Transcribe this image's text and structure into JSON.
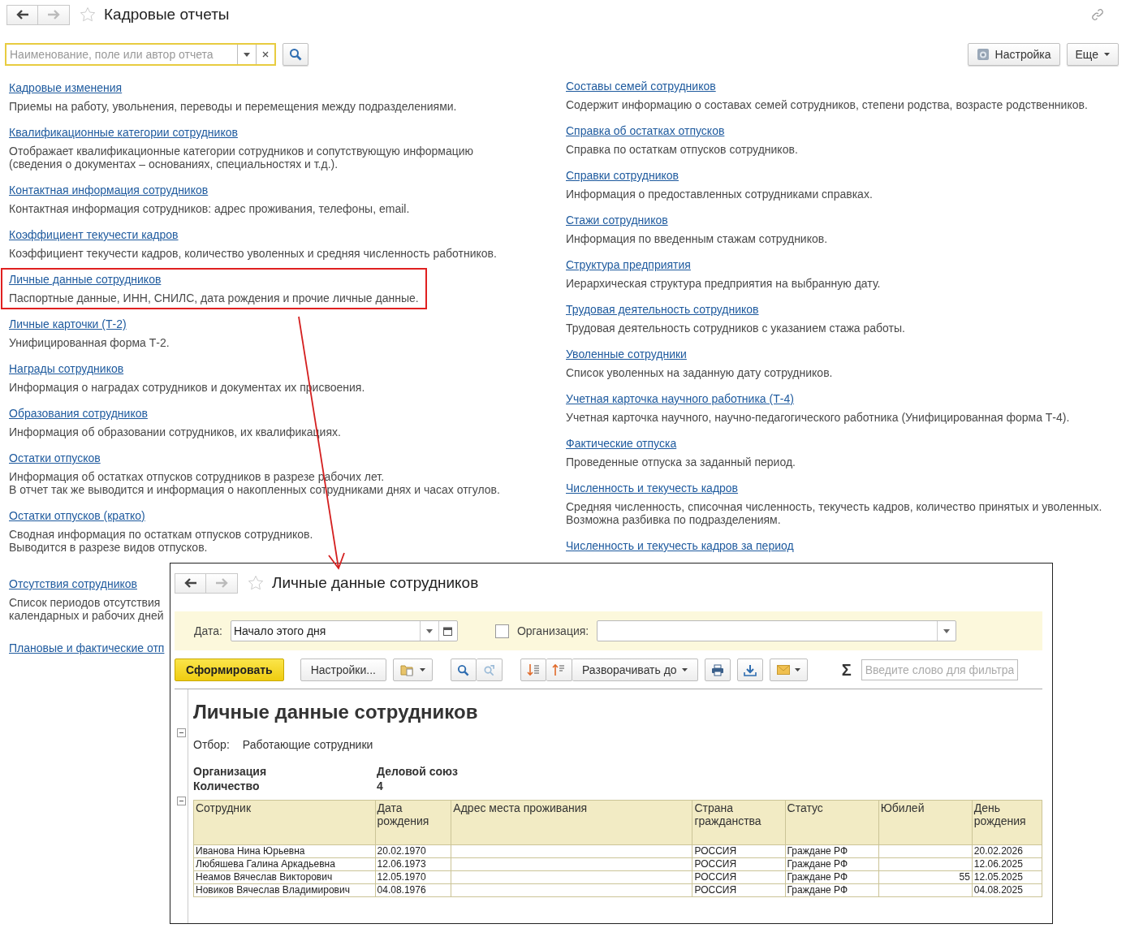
{
  "page": {
    "title": "Кадровые отчеты",
    "search": {
      "placeholder": "Наименование, поле или автор отчета"
    },
    "buttons": [
      {
        "label": "Настройка"
      },
      {
        "label": "Еще"
      }
    ]
  },
  "left_column": [
    {
      "title": "Кадровые изменения",
      "description": "Приемы на работу, увольнения, переводы и перемещения между подразделениями.",
      "highlighted": false
    },
    {
      "title": "Квалификационные категории сотрудников",
      "description": "Отображает квалификационные категории сотрудников и сопутствующую информацию (сведения о документах – основаниях, специальностях и т.д.).",
      "highlighted": false
    },
    {
      "title": "Контактная информация сотрудников",
      "description": "Контактная информация сотрудников: адрес проживания, телефоны, email.",
      "highlighted": false
    },
    {
      "title": "Коэффициент текучести кадров",
      "description": "Коэффициент текучести кадров, количество уволенных и средняя численность работников.",
      "highlighted": false
    },
    {
      "title": "Личные данные сотрудников",
      "description": "Паспортные данные, ИНН, СНИЛС, дата рождения и прочие личные данные.",
      "highlighted": true
    },
    {
      "title": "Личные карточки (Т-2)",
      "description": "Унифицированная форма Т-2.",
      "highlighted": false
    },
    {
      "title": "Награды сотрудников",
      "description": "Информация о наградах сотрудников и документах их присвоения.",
      "highlighted": false
    },
    {
      "title": "Образования сотрудников",
      "description": "Информация об образовании сотрудников, их квалификациях.",
      "highlighted": false
    },
    {
      "title": "Остатки отпусков",
      "description": "Информация об остатках отпусков сотрудников в разрезе рабочих лет.\nВ отчет так же выводится и информация о накопленных сотрудниками днях и часах отгулов.",
      "highlighted": false
    },
    {
      "title": "Остатки отпусков (кратко)",
      "description": "Сводная информация по остаткам отпусков сотрудников.\nВыводится в разрезе видов отпусков.",
      "highlighted": false
    },
    {
      "title": "Отсутствия сотрудников",
      "description": "Список периодов отсутствия календарных и рабочих дней",
      "highlighted": false
    },
    {
      "title": "Плановые и фактические отп",
      "highlighted": false
    }
  ],
  "right_column": [
    {
      "title": "Составы семей сотрудников",
      "description": "Содержит информацию о составах семей сотрудников, степени родства, возрасте родственников.",
      "highlighted": false
    },
    {
      "title": "Справка об остатках отпусков",
      "description": "Справка по остаткам отпусков сотрудников.",
      "highlighted": false
    },
    {
      "title": "Справки сотрудников",
      "description": "Информация о предоставленных сотрудниками справках.",
      "highlighted": false
    },
    {
      "title": "Стажи сотрудников",
      "description": "Информация по введенным стажам сотрудников.",
      "highlighted": false
    },
    {
      "title": "Структура предприятия",
      "description": "Иерархическая структура предприятия на выбранную дату.",
      "highlighted": false
    },
    {
      "title": "Трудовая деятельность сотрудников",
      "description": "Трудовая деятельность сотрудников с указанием стажа работы.",
      "highlighted": false
    },
    {
      "title": "Уволенные сотрудники",
      "description": "Список уволенных на заданную дату сотрудников.",
      "highlighted": false
    },
    {
      "title": "Учетная карточка научного работника (Т-4)",
      "description": "Учетная карточка научного, научно-педагогического работника (Унифицированная форма Т-4).",
      "highlighted": false
    },
    {
      "title": "Фактические отпуска",
      "description": "Проведенные отпуска за заданный период.",
      "highlighted": false
    },
    {
      "title": "Численность и текучесть кадров",
      "description": "Средняя численность, списочная численность, текучесть кадров, количество принятых и уволенных. Возможна разбивка по подразделениям.",
      "highlighted": false
    },
    {
      "title": "Численность и текучесть кадров за период",
      "highlighted": false
    }
  ],
  "report_window": {
    "title": "Личные данные сотрудников",
    "filters": {
      "date_label": "Дата:",
      "date_value": "Начало этого дня",
      "organization_checked": false,
      "organization_label": "Организация:"
    },
    "toolbar": {
      "generate": "Сформировать",
      "settings": "Настройки...",
      "expand": "Разворачивать до",
      "sum_symbol": "Σ",
      "filter_placeholder": "Введите слово для фильтра"
    },
    "report": {
      "title": "Личные данные сотрудников",
      "filter_label": "Отбор:",
      "filter_value": "Работающие сотрудники",
      "params": [
        {
          "name": "Организация",
          "value": "Деловой союз"
        },
        {
          "name": "Количество",
          "value": "4"
        }
      ],
      "table": {
        "columns": [
          {
            "label": "Сотрудник",
            "kind": "text"
          },
          {
            "label": "Дата рождения",
            "kind": "text"
          },
          {
            "label": "Адрес места проживания",
            "kind": "text"
          },
          {
            "label": "Страна гражданства",
            "kind": "text"
          },
          {
            "label": "Статус",
            "kind": "text"
          },
          {
            "label": "Юбилей",
            "kind": "number"
          },
          {
            "label": "День рождения",
            "kind": "text"
          }
        ],
        "rows": [
          [
            "Иванова Нина Юрьевна",
            "20.02.1970",
            "",
            "РОССИЯ",
            "Граждане РФ",
            "",
            "20.02.2026"
          ],
          [
            "Любяшева Галина Аркадьевна",
            "12.06.1973",
            "",
            "РОССИЯ",
            "Граждане РФ",
            "",
            "12.06.2025"
          ],
          [
            "Неамов Вячеслав Викторович",
            "12.05.1970",
            "",
            "РОССИЯ",
            "Граждане РФ",
            "55",
            "12.05.2025"
          ],
          [
            "Новиков Вячеслав Владимирович",
            "04.08.1976",
            "",
            "РОССИЯ",
            "Граждане РФ",
            "",
            "04.08.2025"
          ]
        ]
      }
    }
  }
}
